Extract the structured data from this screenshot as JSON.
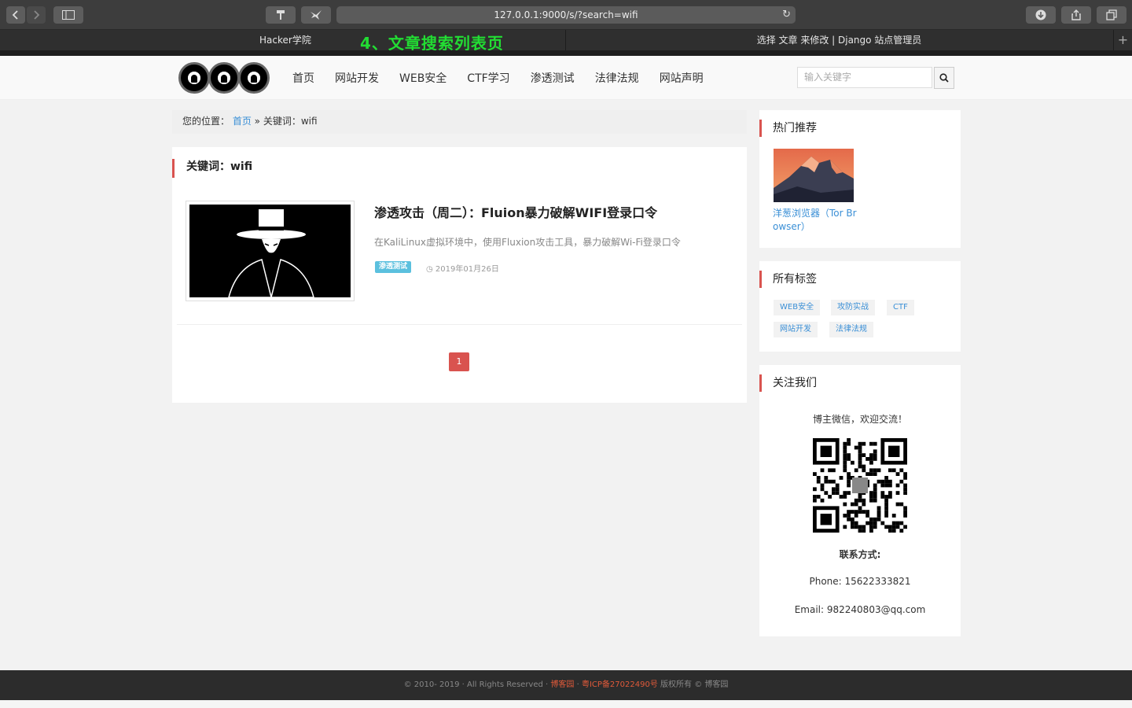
{
  "browser": {
    "url": "127.0.0.1:9000/s/?search=wifi",
    "tabs": [
      {
        "label": "Hacker学院"
      },
      {
        "label": "选择 文章 来修改 | Django 站点管理员"
      }
    ],
    "overlay_title": "4、文章搜索列表页"
  },
  "header": {
    "nav": [
      "首页",
      "网站开发",
      "WEB安全",
      "CTF学习",
      "渗透测试",
      "法律法规",
      "网站声明"
    ],
    "search_placeholder": "输入关键字"
  },
  "breadcrumb": {
    "prefix": "您的位置：",
    "home": "首页",
    "sep": " » ",
    "current": "关键词：wifi"
  },
  "main": {
    "heading": "关键词：wifi",
    "article": {
      "title": "渗透攻击（周二）：Fluion暴力破解WIFI登录口令",
      "desc": "在KaliLinux虚拟环境中，使用Fluxion攻击工具，暴力破解Wi-Fi登录口令",
      "tag": "渗透测试",
      "date": "2019年01月26日"
    },
    "page": "1"
  },
  "sidebar": {
    "hot": {
      "title": "热门推荐",
      "link": "洋葱浏览器（Tor Browser）"
    },
    "tags": {
      "title": "所有标签",
      "items": [
        "WEB安全",
        "攻防实战",
        "CTF",
        "网站开发",
        "法律法规"
      ]
    },
    "follow": {
      "title": "关注我们",
      "wechat": "博主微信，欢迎交流！",
      "contact_label": "联系方式:",
      "phone": "Phone: 15622333821",
      "email": "Email:  982240803@qq.com"
    }
  },
  "footer": {
    "copy": "© 2010- 2019 · All Rights Reserved ·",
    "site": "博客园",
    "dot": "·",
    "icp": "粤ICP备27022490号",
    "rights": "版权所有 © 博客园"
  },
  "colors": {
    "accent": "#d9534f",
    "link": "#3a8fd6",
    "tag": "#5bc0de",
    "overlay": "#22dd33"
  }
}
